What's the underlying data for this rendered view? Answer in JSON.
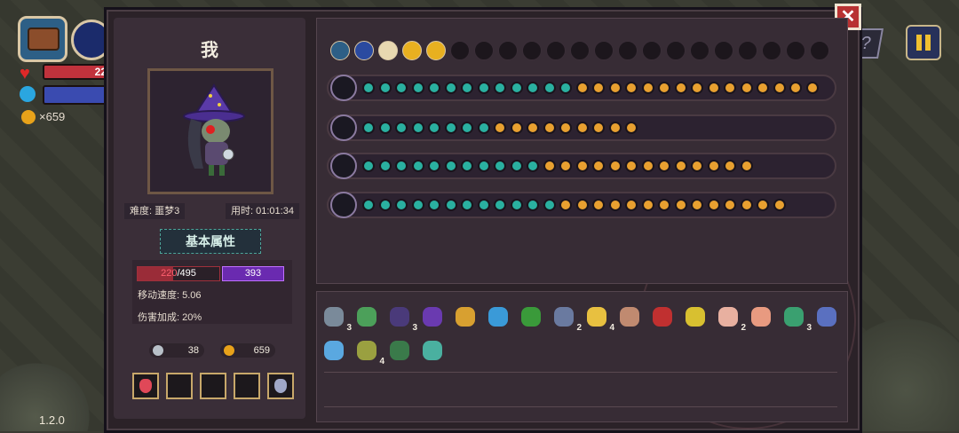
{
  "hud": {
    "hp_value": "22",
    "coins": "×659",
    "version": "1.2.0"
  },
  "buttons": {
    "help": "?",
    "close": "✕"
  },
  "character": {
    "name": "我",
    "difficulty_label": "难度: 噩梦3",
    "time_label": "用时: 01:01:34",
    "attributes_button": "基本属性",
    "hp_current": "220",
    "hp_max": "/495",
    "hp_fraction": 0.44,
    "mana": "393",
    "move_speed": "移动速度: 5.06",
    "damage_bonus": "伤害加成: 20%",
    "keys": "38",
    "gold": "659"
  },
  "weapon_rows": [
    {
      "name": "staff-1",
      "rune_count": 28
    },
    {
      "name": "staff-2",
      "rune_count": 17
    },
    {
      "name": "staff-3",
      "rune_count": 24
    },
    {
      "name": "staff-4",
      "rune_count": 26
    }
  ],
  "bag": {
    "row1": [
      {
        "icon": "helmet",
        "count": "3",
        "color": "#7a8a9a"
      },
      {
        "icon": "leaf",
        "count": "",
        "color": "#4ca05a"
      },
      {
        "icon": "robe",
        "count": "3",
        "color": "#4a3a7a"
      },
      {
        "icon": "wizard-hat",
        "count": "",
        "color": "#6a3ab0"
      },
      {
        "icon": "chalice",
        "count": "",
        "color": "#d8a030"
      },
      {
        "icon": "crystal",
        "count": "",
        "color": "#3a9ad8"
      },
      {
        "icon": "plant",
        "count": "",
        "color": "#3a9a3a"
      },
      {
        "icon": "glove",
        "count": "2",
        "color": "#6a7aa0"
      },
      {
        "icon": "potion",
        "count": "4",
        "color": "#e8c040"
      },
      {
        "icon": "shell",
        "count": "",
        "color": "#c08a70"
      },
      {
        "icon": "heart-gem",
        "count": "",
        "color": "#c03030"
      },
      {
        "icon": "battery",
        "count": "",
        "color": "#d8c030"
      },
      {
        "icon": "feather",
        "count": "2",
        "color": "#e8b0a0"
      },
      {
        "icon": "creature",
        "count": "",
        "color": "#e89a80"
      },
      {
        "icon": "scarf",
        "count": "3",
        "color": "#3aa070"
      },
      {
        "icon": "bottle",
        "count": "",
        "color": "#5a70c0"
      }
    ],
    "row2": [
      {
        "icon": "magnifier",
        "count": "",
        "color": "#5aa8e0"
      },
      {
        "icon": "book",
        "count": "4",
        "color": "#9aa040"
      },
      {
        "icon": "boot",
        "count": "",
        "color": "#3a7a4a"
      },
      {
        "icon": "arrows",
        "count": "",
        "color": "#4ab0a0"
      }
    ]
  },
  "colors": {
    "panel": "#2b2228",
    "hp": "#c0323c",
    "mana": "#6a2ab0",
    "rune_teal": "#2ab0a0",
    "rune_gold": "#e8a030"
  }
}
